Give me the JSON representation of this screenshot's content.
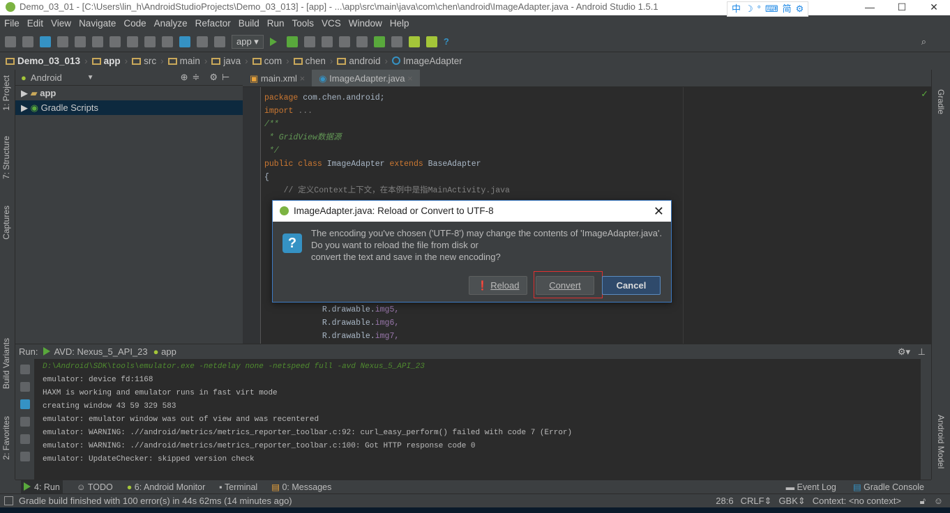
{
  "window": {
    "title": "Demo_03_01 - [C:\\Users\\lin_h\\AndroidStudioProjects\\Demo_03_013] - [app] - ...\\app\\src\\main\\java\\com\\chen\\android\\ImageAdapter.java - Android Studio 1.5.1",
    "controls": [
      "—",
      "☐",
      "✕"
    ]
  },
  "ime": [
    "中",
    "☽",
    "°",
    "⌨",
    "简",
    "⚙"
  ],
  "menu": [
    "File",
    "Edit",
    "View",
    "Navigate",
    "Code",
    "Analyze",
    "Refactor",
    "Build",
    "Run",
    "Tools",
    "VCS",
    "Window",
    "Help"
  ],
  "toolbar": {
    "run_config": "app ▾"
  },
  "breadcrumbs": [
    "Demo_03_013",
    "app",
    "src",
    "main",
    "java",
    "com",
    "chen",
    "android",
    "ImageAdapter"
  ],
  "left_tabs": [
    "1: Project",
    "7: Structure",
    "Captures",
    "Build Variants",
    "2: Favorites"
  ],
  "right_tabs": [
    "Gradle",
    "Android Model"
  ],
  "project": {
    "view": "Android",
    "items": [
      "app",
      "Gradle Scripts"
    ]
  },
  "editor_tabs": [
    "main.xml",
    "ImageAdapter.java"
  ],
  "code": {
    "l1a": "package",
    "l1b": " com.chen.android;",
    "l2a": "import",
    "l2b": " ...",
    "l3": "/**",
    "l4": " * GridView数据源",
    "l5": " */",
    "l6a": "public class",
    "l6b": " ImageAdapter ",
    "l6c": "extends",
    "l6d": " BaseAdapter",
    "l7": "{",
    "l8": "    // 定义Context上下文，在本例中是指MainActivity.java",
    "l9": "            R.drawable.",
    "l9b": "img5,",
    "l10": "            R.drawable.",
    "l10b": "img6,",
    "l11": "            R.drawable.",
    "l11b": "img7,"
  },
  "dialog": {
    "title": "ImageAdapter.java: Reload or Convert to UTF-8",
    "message": [
      "The encoding you've chosen ('UTF-8') may change the contents of 'ImageAdapter.java'.",
      "Do you want to reload the file from disk or",
      "convert the text and save in the new encoding?"
    ],
    "reload": "Reload",
    "convert": "Convert",
    "cancel": "Cancel"
  },
  "run": {
    "label": "Run:",
    "tabs": [
      "AVD: Nexus_5_API_23",
      "app"
    ],
    "console": [
      "D:\\Android\\SDK\\tools\\emulator.exe -netdelay none -netspeed full -avd Nexus_5_API_23",
      "emulator: device fd:1168",
      "HAXM is working and emulator runs in fast virt mode",
      "creating window 43 59 329 583",
      "emulator: emulator window was out of view and was recentered",
      "emulator: WARNING: .//android/metrics/metrics_reporter_toolbar.c:92: curl_easy_perform() failed with code 7 (Error)",
      "emulator: WARNING: .//android/metrics/metrics_reporter_toolbar.c:100: Got HTTP response code 0",
      "emulator: UpdateChecker: skipped version check"
    ]
  },
  "bottom_tabs": [
    "4: Run",
    "TODO",
    "6: Android Monitor",
    "Terminal",
    "0: Messages"
  ],
  "bottom_right_tabs": [
    "Event Log",
    "Gradle Console"
  ],
  "status": {
    "message": "Gradle build finished with 100 error(s) in 44s 62ms (14 minutes ago)",
    "position": "28:6",
    "line_sep": "CRLF⇕",
    "encoding": "GBK⇕",
    "context": "Context: <no context>"
  }
}
